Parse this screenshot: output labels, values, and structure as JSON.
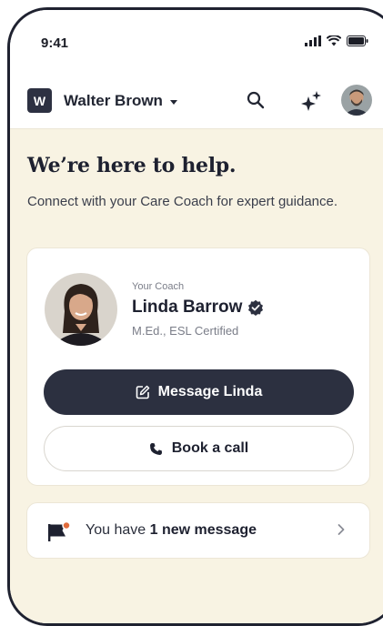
{
  "status_bar": {
    "time": "9:41"
  },
  "header": {
    "workspace_initial": "W",
    "workspace_name": "Walter Brown"
  },
  "hero": {
    "title": "We’re here to help.",
    "subtitle": "Connect with your Care Coach for expert guidance."
  },
  "coach": {
    "eyebrow": "Your Coach",
    "name": "Linda Barrow",
    "credentials": "M.Ed., ESL Certified",
    "message_button": "Message Linda",
    "call_button": "Book a call"
  },
  "messages": {
    "prefix": "You have ",
    "count_text": "1 new message"
  },
  "icons": {
    "search": "search-icon",
    "sparkle": "sparkle-icon",
    "verified": "verified-badge-icon",
    "edit": "edit-message-icon",
    "phone": "phone-icon",
    "flag": "flag-icon",
    "chevron": "chevron-right-icon"
  },
  "colors": {
    "primary_dark": "#2c3040",
    "background_cream": "#f8f3e3",
    "card_white": "#ffffff",
    "notification_dot": "#e06b3c"
  }
}
